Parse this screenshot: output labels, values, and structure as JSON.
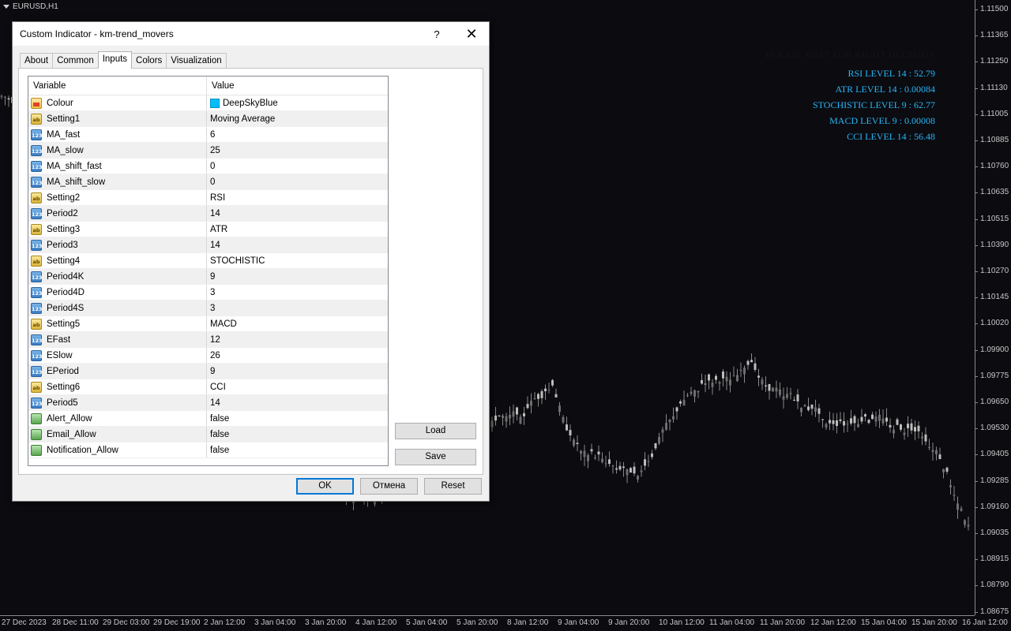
{
  "chart": {
    "symbol": "EURUSD,H1",
    "price_levels": [
      "1.11500",
      "1.11365",
      "1.11250",
      "1.11130",
      "1.11005",
      "1.10885",
      "1.10760",
      "1.10635",
      "1.10515",
      "1.10390",
      "1.10270",
      "1.10145",
      "1.10020",
      "1.09900",
      "1.09775",
      "1.09650",
      "1.09530",
      "1.09405",
      "1.09285",
      "1.09160",
      "1.09035",
      "1.08915",
      "1.08790",
      "1.08675"
    ],
    "time_labels": [
      "27 Dec 2023",
      "28 Dec 11:00",
      "29 Dec 03:00",
      "29 Dec 19:00",
      "2 Jan 12:00",
      "3 Jan 04:00",
      "3 Jan 20:00",
      "4 Jan 12:00",
      "5 Jan 04:00",
      "5 Jan 20:00",
      "8 Jan 12:00",
      "9 Jan 04:00",
      "9 Jan 20:00",
      "10 Jan 12:00",
      "11 Jan 04:00",
      "11 Jan 20:00",
      "12 Jan 12:00",
      "15 Jan 04:00",
      "15 Jan 20:00",
      "16 Jan 12:00"
    ],
    "overlay": {
      "wait_text": "PLEASE WAIT FOR RIGHT DECISION",
      "levels": [
        "RSI LEVEL 14 : 52.79",
        "ATR LEVEL 14 : 0.00084",
        "STOCHISTIC LEVEL 9 : 62.77",
        "MACD LEVEL 9 : 0.00008",
        "CCI LEVEL 14 : 56.48"
      ],
      "color": "#29b6f6"
    }
  },
  "dialog": {
    "title": "Custom Indicator - km-trend_movers",
    "help": "?",
    "close": "✕",
    "tabs": [
      {
        "label": "About",
        "active": false
      },
      {
        "label": "Common",
        "active": false
      },
      {
        "label": "Inputs",
        "active": true
      },
      {
        "label": "Colors",
        "active": false
      },
      {
        "label": "Visualization",
        "active": false
      }
    ],
    "grid": {
      "col_variable": "Variable",
      "col_value": "Value",
      "rows": [
        {
          "name": "Colour",
          "value": "DeepSkyBlue",
          "type": "color"
        },
        {
          "name": "Setting1",
          "value": "Moving Average",
          "type": "string"
        },
        {
          "name": "MA_fast",
          "value": "6",
          "type": "number"
        },
        {
          "name": "MA_slow",
          "value": "25",
          "type": "number"
        },
        {
          "name": "MA_shift_fast",
          "value": "0",
          "type": "number"
        },
        {
          "name": "MA_shift_slow",
          "value": "0",
          "type": "number"
        },
        {
          "name": "Setting2",
          "value": "RSI",
          "type": "string"
        },
        {
          "name": "Period2",
          "value": "14",
          "type": "number"
        },
        {
          "name": "Setting3",
          "value": "ATR",
          "type": "string"
        },
        {
          "name": "Period3",
          "value": "14",
          "type": "number"
        },
        {
          "name": "Setting4",
          "value": "STOCHISTIC",
          "type": "string"
        },
        {
          "name": "Period4K",
          "value": "9",
          "type": "number"
        },
        {
          "name": "Period4D",
          "value": "3",
          "type": "number"
        },
        {
          "name": "Period4S",
          "value": "3",
          "type": "number"
        },
        {
          "name": "Setting5",
          "value": "MACD",
          "type": "string"
        },
        {
          "name": "EFast",
          "value": "12",
          "type": "number"
        },
        {
          "name": "ESlow",
          "value": "26",
          "type": "number"
        },
        {
          "name": "EPeriod",
          "value": "9",
          "type": "number"
        },
        {
          "name": "Setting6",
          "value": "CCI",
          "type": "string"
        },
        {
          "name": "Period5",
          "value": "14",
          "type": "number"
        },
        {
          "name": "Alert_Allow",
          "value": "false",
          "type": "bool"
        },
        {
          "name": "Email_Allow",
          "value": "false",
          "type": "bool"
        },
        {
          "name": "Notification_Allow",
          "value": "false",
          "type": "bool"
        }
      ]
    },
    "buttons": {
      "load": "Load",
      "save": "Save",
      "ok": "OK",
      "cancel": "Отмена",
      "reset": "Reset"
    }
  }
}
